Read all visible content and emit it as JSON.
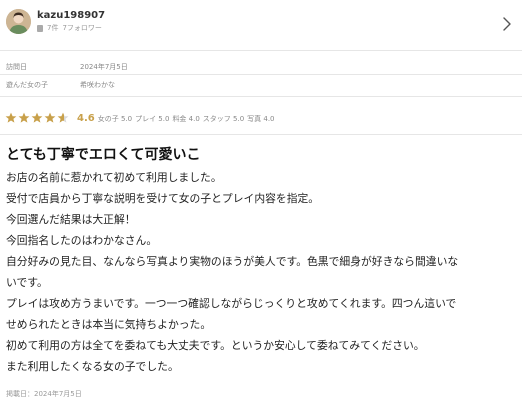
{
  "user": {
    "name": "kazu198907",
    "posts": "7件",
    "follows": "7フォロワー"
  },
  "visit": {
    "date_label": "訪問日",
    "date_value": "2024年7月5日",
    "girl_label": "遊んだ女の子",
    "girl_value": "希咲わかな"
  },
  "rating": {
    "score": "4.6",
    "stars_value": 4.6,
    "stars_max": 5,
    "star_color": "#c8a04a",
    "subs": [
      {
        "label": "女の子",
        "value": "5.0"
      },
      {
        "label": "プレイ",
        "value": "5.0"
      },
      {
        "label": "料金",
        "value": "4.0"
      },
      {
        "label": "スタッフ",
        "value": "5.0"
      },
      {
        "label": "写真",
        "value": "4.0"
      }
    ]
  },
  "review": {
    "title": "とても丁寧でエロくて可愛いこ",
    "lines": [
      "お店の名前に惹かれて初めて利用しました。",
      "受付で店員から丁寧な説明を受けて女の子とプレイ内容を指定。",
      "今回選んだ結果は大正解！",
      "今回指名したのはわかなさん。",
      "自分好みの見た目、なんなら写真より実物のほうが美人です。色黒で細身が好きなら間違いな",
      "いです。",
      "プレイは攻め方うまいです。一つ一つ確認しながらじっくりと攻めてくれます。四つん這いで",
      "せめられたときは本当に気持ちよかった。",
      "初めて利用の方は全てを委ねても大丈夫です。というか安心して委ねてみてください。",
      "また利用したくなる女の子でした。"
    ],
    "posted": "掲載日：2024年7月5日"
  }
}
